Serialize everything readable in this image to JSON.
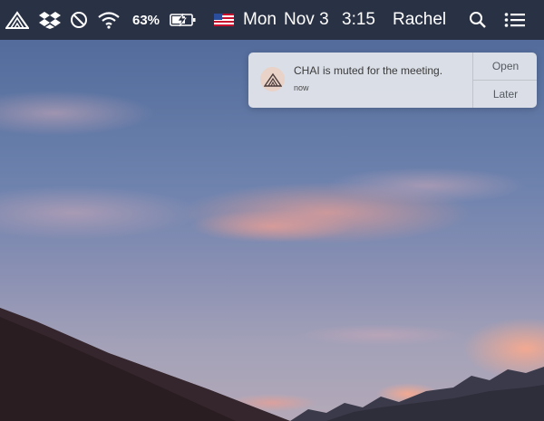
{
  "menubar": {
    "app_icon": "chai-mountain-icon",
    "icons": [
      "dropbox-icon",
      "do-not-disturb-icon",
      "wifi-icon",
      "battery-charging-icon",
      "us-flag-icon",
      "spotlight-search-icon",
      "notification-center-icon"
    ],
    "battery_percent": "63%",
    "day": "Mon",
    "date": "Nov 3",
    "time": "3:15",
    "user": "Rachel"
  },
  "notification": {
    "app_icon": "chai-mountain-icon",
    "title": "CHAI is muted for the meeting.",
    "timestamp": "now",
    "open_label": "Open",
    "later_label": "Later"
  },
  "colors": {
    "menubar_bg": "#262c3e",
    "notification_bg": "#e2e4ea",
    "desktop_sky": "#5c74a2",
    "cloud_pink": "#e89a8c"
  }
}
